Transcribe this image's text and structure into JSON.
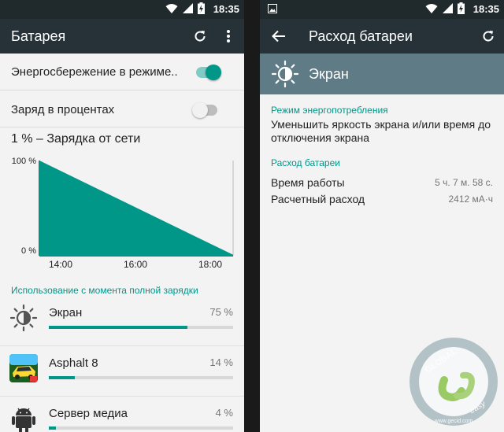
{
  "status": {
    "time": "18:35"
  },
  "left": {
    "appbar": {
      "title": "Батарея"
    },
    "settings": [
      {
        "label": "Энергосбережение в режиме..",
        "enabled": true
      },
      {
        "label": "Заряд в процентах",
        "enabled": false
      }
    ],
    "charge_status": "1 % – Зарядка от сети",
    "chart_data": {
      "type": "area",
      "x": [
        "13:00",
        "18:35"
      ],
      "y_ticks": [
        "100 %",
        "0 %"
      ],
      "x_ticks": [
        "14:00",
        "16:00",
        "18:00"
      ],
      "values": [
        100,
        1
      ],
      "ylim": [
        0,
        100
      ],
      "color": "#009688"
    },
    "usage_header": "Использование с момента полной зарядки",
    "apps": [
      {
        "name": "Экран",
        "percent": "75 %",
        "fraction": 0.75,
        "icon": "screen-brightness-icon"
      },
      {
        "name": "Asphalt 8",
        "percent": "14 %",
        "fraction": 0.14,
        "icon": "asphalt-8-app-icon"
      },
      {
        "name": "Сервер медиа",
        "percent": "4 %",
        "fraction": 0.04,
        "icon": "android-robot-icon"
      }
    ]
  },
  "right": {
    "appbar": {
      "title": "Расход батареи"
    },
    "detail_title": "Экран",
    "power_mode_header": "Режим энергопотребления",
    "power_mode_text": "Уменьшить яркость экрана и/или время до отключения экрана",
    "usage_header": "Расход батареи",
    "stats": [
      {
        "label": "Время работы",
        "value": "5 ч. 7 м. 58 с."
      },
      {
        "label": "Расчетный расход",
        "value": "2412 мА·ч"
      }
    ]
  },
  "watermark": {
    "top": "GLOBAL",
    "bottom": "easy",
    "url": "www.gecid.com"
  },
  "colors": {
    "accent": "#009688",
    "appbar": "#263238",
    "statusbar": "#20292b",
    "detail_header": "#5f7b86"
  }
}
